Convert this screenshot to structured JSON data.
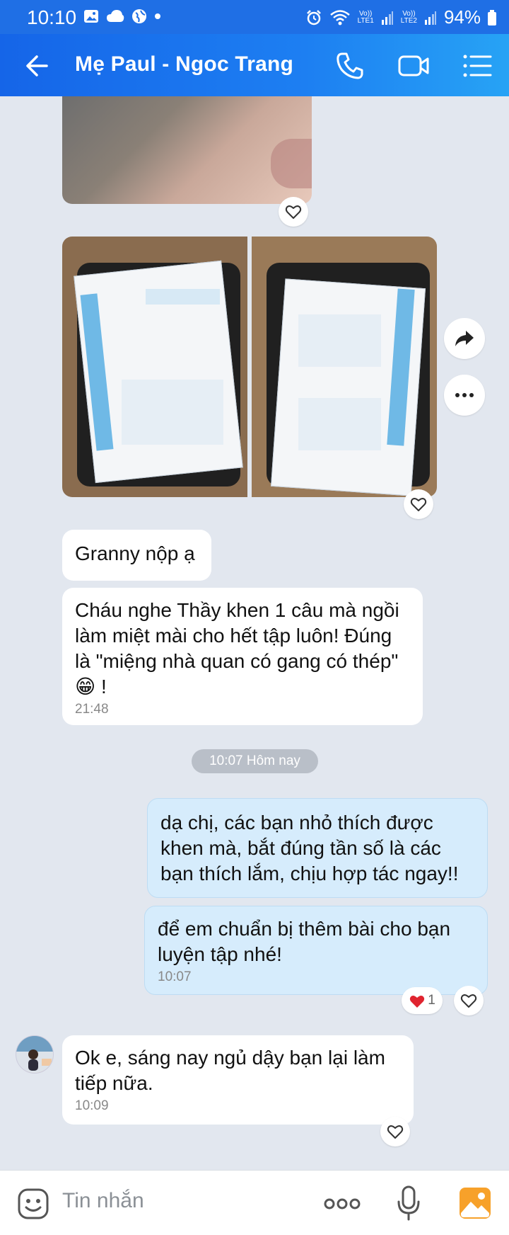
{
  "status_bar": {
    "time": "10:10",
    "net1_top": "Vo))",
    "net1_bottom": "LTE1",
    "net2_top": "Vo))",
    "net2_bottom": "LTE2",
    "battery": "94%"
  },
  "header": {
    "title": "Mẹ Paul - Ngoc Trang",
    "back_icon": "arrow-left-icon",
    "call_icon": "phone-icon",
    "video_icon": "video-camera-icon",
    "menu_icon": "list-menu-icon"
  },
  "messages": {
    "m1": {
      "text": "Granny nộp ạ"
    },
    "m2": {
      "text": "Cháu nghe Thầy khen 1 câu mà ngồi làm miệt mài cho hết tập luôn! Đúng là \"miệng nhà quan có gang có thép\" 😁 !",
      "time": "21:48"
    },
    "date_separator": "10:07 Hôm nay",
    "m3": {
      "text": "dạ chị, các bạn nhỏ thích được khen mà, bắt đúng tần số là các bạn thích lắm, chịu hợp tác ngay!!"
    },
    "m4": {
      "text": "để em chuẩn bị thêm bài cho bạn luyện tập nhé!",
      "time": "10:07",
      "reaction_count": "1"
    },
    "m5": {
      "text": "Ok e, sáng nay ngủ dậy bạn lại làm tiếp nữa.",
      "time": "10:09"
    }
  },
  "composer": {
    "placeholder": "Tin nhắn",
    "emoji_icon": "emoji-icon",
    "more_icon": "more-dots-icon",
    "mic_icon": "microphone-icon",
    "image_icon": "image-icon"
  },
  "colors": {
    "header_start": "#1565e8",
    "header_end": "#27a3f5",
    "chat_bg": "#e2e7ef",
    "my_bubble": "#d6ecfc",
    "reaction_heart": "#e0242f"
  }
}
